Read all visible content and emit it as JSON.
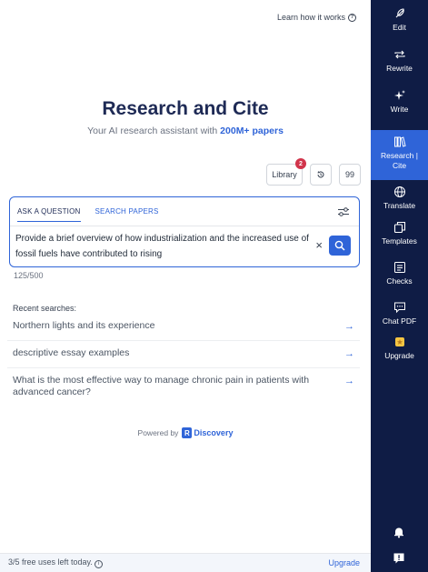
{
  "header": {
    "learn_link": "Learn how it works",
    "help_icon": "question-circle-icon"
  },
  "hero": {
    "title": "Research and Cite",
    "subtitle_prefix": "Your AI research assistant with ",
    "subtitle_highlight": "200M+ papers"
  },
  "toolbar": {
    "library_label": "Library",
    "library_badge": "2",
    "history_icon": "history-icon",
    "cite_label": "99"
  },
  "search": {
    "tabs": [
      {
        "label": "ASK A QUESTION",
        "active": true
      },
      {
        "label": "SEARCH PAPERS",
        "active": false
      }
    ],
    "query": "Provide a brief overview of how industrialization and the increased use of fossil fuels have contributed to rising",
    "char_count": "125/500",
    "clear_icon": "x-icon",
    "search_icon": "search-icon",
    "filter_icon": "sliders-icon"
  },
  "recent": {
    "heading": "Recent searches:",
    "items": [
      "Northern lights and its experience",
      "descriptive essay examples",
      "What is the most effective way to manage chronic pain in patients with advanced cancer?"
    ]
  },
  "powered": {
    "label": "Powered by",
    "brand": "Discovery",
    "brand_mark": "R"
  },
  "footer": {
    "usage": "3/5 free uses left today.",
    "upgrade_label": "Upgrade"
  },
  "sidebar": {
    "items": [
      {
        "key": "edit",
        "label": "Edit",
        "icon": "feather-icon"
      },
      {
        "key": "rewrite",
        "label": "Rewrite",
        "icon": "repeat-icon"
      },
      {
        "key": "write",
        "label": "Write",
        "icon": "sparkles-icon"
      },
      {
        "key": "research",
        "label": "Research | Cite",
        "icon": "books-icon",
        "active": true
      },
      {
        "key": "translate",
        "label": "Translate",
        "icon": "globe-icon"
      },
      {
        "key": "templates",
        "label": "Templates",
        "icon": "copy-icon"
      },
      {
        "key": "checks",
        "label": "Checks",
        "icon": "checklist-icon"
      },
      {
        "key": "chat",
        "label": "Chat PDF",
        "icon": "chat-icon"
      },
      {
        "key": "upgrade",
        "label": "Upgrade",
        "icon": "star-badge-icon"
      }
    ],
    "bottom_icons": [
      "bell-icon",
      "feedback-icon"
    ]
  },
  "colors": {
    "accent": "#2f64d8",
    "sidebar_bg": "#0f1c45",
    "badge": "#d1344b",
    "title": "#1e2a55"
  }
}
